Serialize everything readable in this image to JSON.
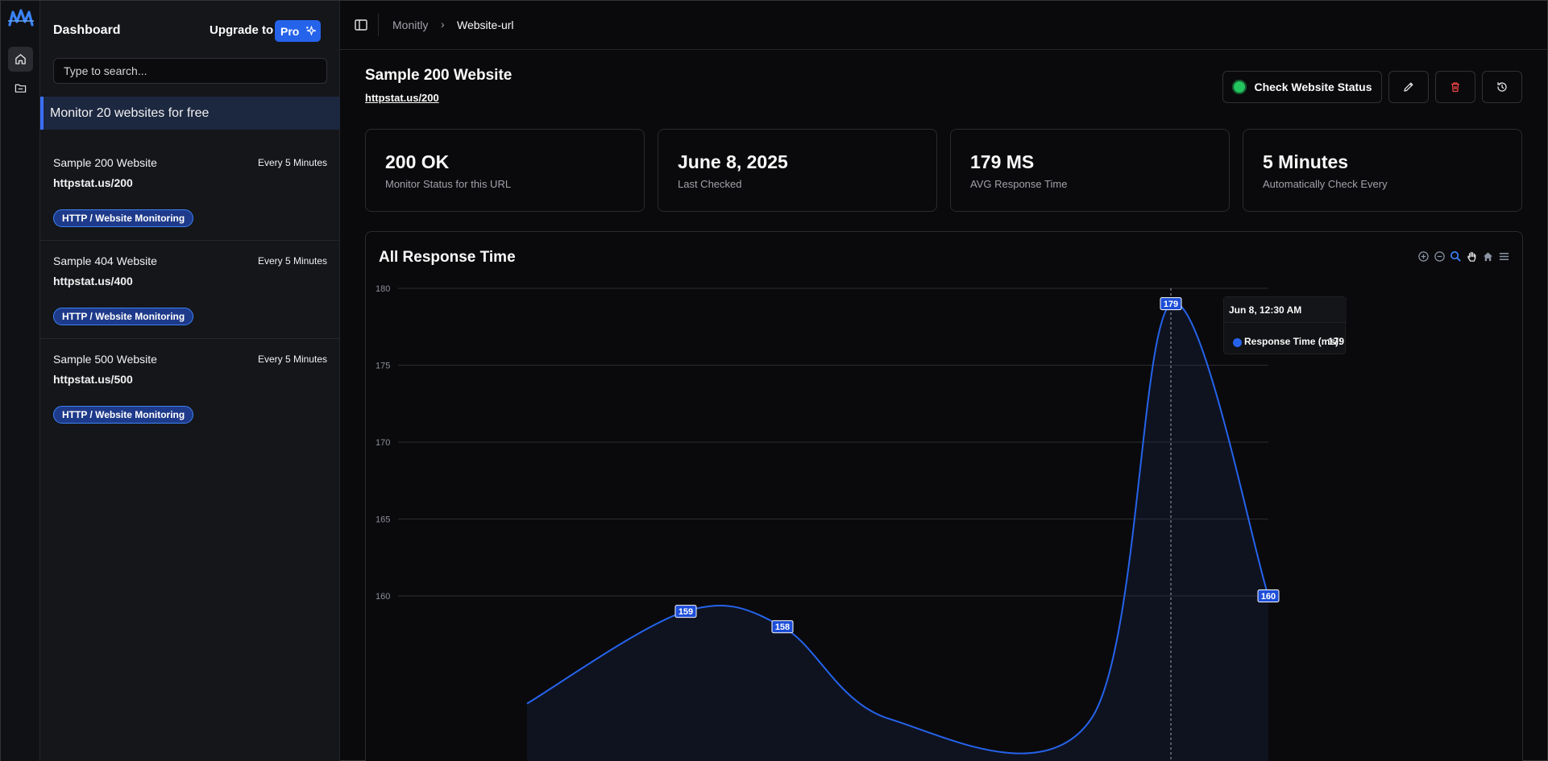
{
  "sidebar": {
    "title": "Dashboard",
    "upgrade_label": "Upgrade to",
    "pro_label": "Pro",
    "search_placeholder": "Type to search...",
    "promo": "Monitor 20 websites for free",
    "monitors": [
      {
        "name": "Sample 200 Website",
        "frequency": "Every 5 Minutes",
        "url": "httpstat.us/200",
        "tag": "HTTP / Website Monitoring"
      },
      {
        "name": "Sample 404 Website",
        "frequency": "Every 5 Minutes",
        "url": "httpstat.us/400",
        "tag": "HTTP / Website Monitoring"
      },
      {
        "name": "Sample 500 Website",
        "frequency": "Every 5 Minutes",
        "url": "httpstat.us/500",
        "tag": "HTTP / Website Monitoring"
      }
    ]
  },
  "rail": {
    "icons": [
      "monitly-logo-icon",
      "home-icon",
      "folder-icon"
    ]
  },
  "breadcrumb": {
    "root": "Monitly",
    "separator": "›",
    "current": "Website-url"
  },
  "page": {
    "title": "Sample 200 Website",
    "url": "httpstat.us/200",
    "check_button": "Check Website Status",
    "status_color": "#22c55e"
  },
  "stats": [
    {
      "value": "200 OK",
      "label": "Monitor Status for this URL"
    },
    {
      "value": "June 8, 2025",
      "label": "Last Checked"
    },
    {
      "value": "179 MS",
      "label": "AVG Response Time"
    },
    {
      "value": "5 Minutes",
      "label": "Automatically Check Every"
    }
  ],
  "chart": {
    "title": "All Response Time",
    "toolbar": [
      "zoom-in-icon",
      "zoom-out-icon",
      "zoom-select-icon",
      "pan-hand-icon",
      "reset-home-icon",
      "menu-icon"
    ],
    "tooltip": {
      "header": "Jun 8, 12:30 AM",
      "series_label": "Response Time (ms):",
      "value": "179"
    }
  },
  "chart_data": {
    "type": "area",
    "title": "All Response Time",
    "y_ticks": [
      "180",
      "175",
      "170",
      "165",
      "160"
    ],
    "ylim": [
      150,
      180
    ],
    "series": [
      {
        "name": "Response Time (ms)",
        "color": "#2563eb",
        "points": [
          {
            "t": 0,
            "y": 153
          },
          {
            "t": 1,
            "y": 159
          },
          {
            "t": 2,
            "y": 158
          },
          {
            "t": 3,
            "y": 152
          },
          {
            "t": 4,
            "y": 152
          },
          {
            "t": 5,
            "y": 179
          },
          {
            "t": 6,
            "y": 160
          }
        ]
      }
    ],
    "labeled_points": [
      1,
      2,
      5,
      6
    ],
    "grid": true
  }
}
